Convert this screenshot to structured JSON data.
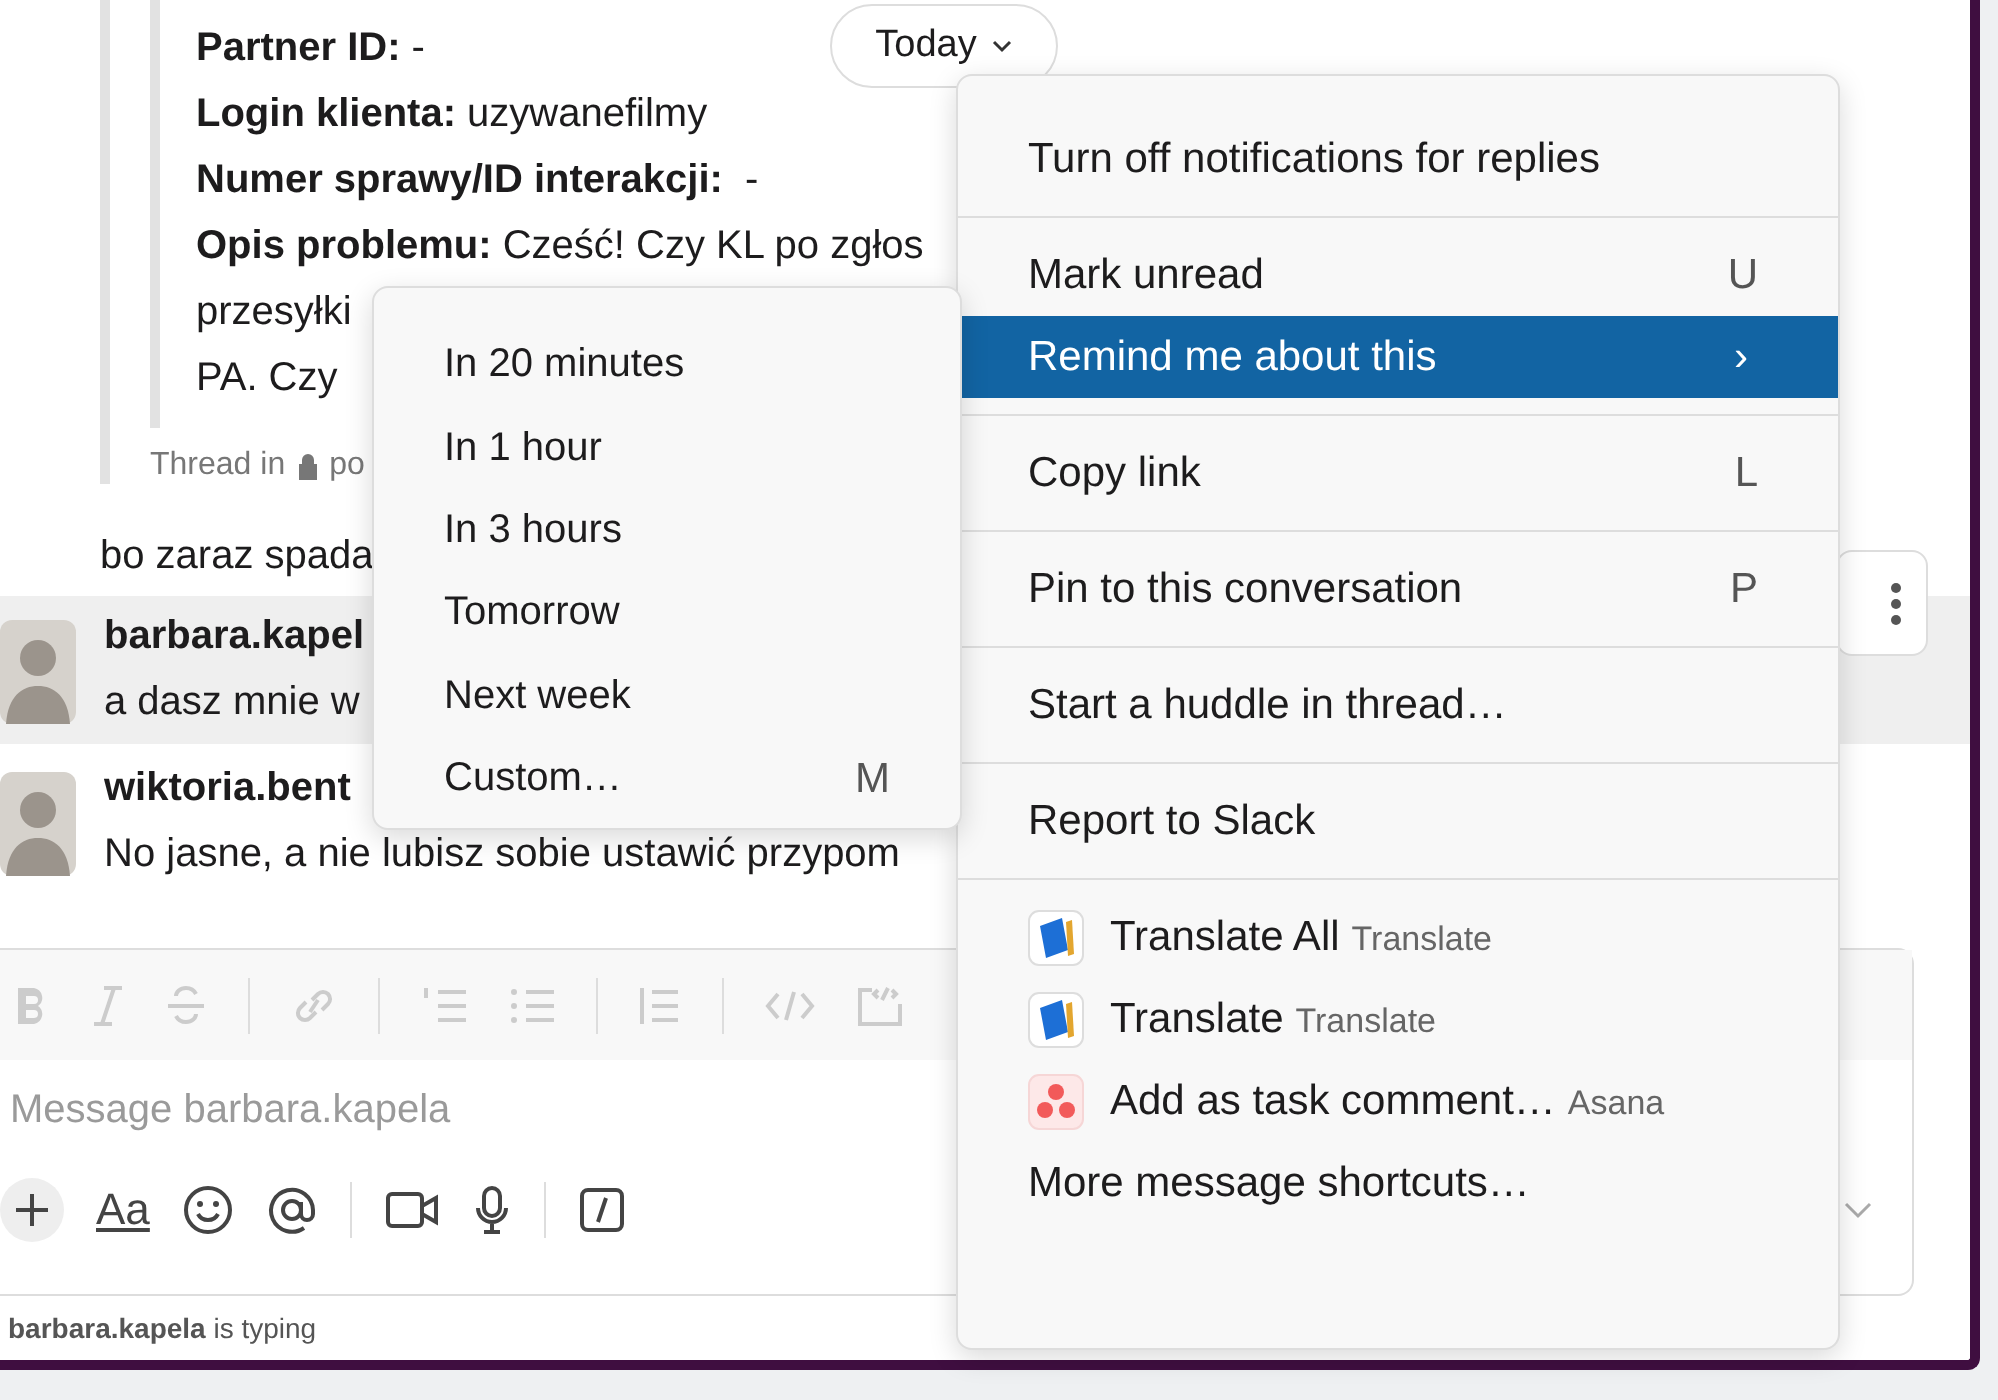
{
  "quote": {
    "lines": [
      "**Partner ID:** -",
      "**Login klienta:** uzywanefilmy",
      "**Numer sprawy/ID interakcji:**  -",
      "**Opis problemu:** Cześć! Czy KL po zgłos",
      "przesyłki",
      "PA. Czy"
    ],
    "thread_prefix": "Thread in",
    "thread_channel": "po"
  },
  "date_pill": {
    "label": "Today"
  },
  "messages": [
    {
      "text": "bo zaraz spada",
      "highlighted": false
    },
    {
      "author": "barbara.kapel",
      "text": "a dasz mnie w",
      "highlighted": true
    },
    {
      "author": "wiktoria.bent",
      "text": "No jasne, a nie lubisz sobie ustawić przypom",
      "highlighted": false
    }
  ],
  "composer": {
    "placeholder": "Message barbara.kapela",
    "format_label": "Aa"
  },
  "typing": {
    "name": "barbara.kapela",
    "text": " is typing"
  },
  "menu": {
    "sections": [
      [
        {
          "kind": "plain",
          "label": "Turn off notifications for replies",
          "selected": false
        }
      ],
      [
        {
          "kind": "plain",
          "label": "Mark unread",
          "shortcut": "U",
          "selected": false
        },
        {
          "kind": "submenu",
          "label": "Remind me about this",
          "shortcut": "›",
          "selected": true
        }
      ],
      [
        {
          "kind": "plain",
          "label": "Copy link",
          "shortcut": "L",
          "selected": false
        }
      ],
      [
        {
          "kind": "plain",
          "label": "Pin to this conversation",
          "shortcut": "P",
          "selected": false
        }
      ],
      [
        {
          "kind": "plain",
          "label": "Start a huddle in thread…",
          "selected": false
        }
      ],
      [
        {
          "kind": "plain",
          "label": "Report to Slack",
          "selected": false
        }
      ],
      [
        {
          "kind": "book-app",
          "label": "Translate All",
          "app": "Translate",
          "selected": false
        },
        {
          "kind": "book-app",
          "label": "Translate",
          "app": "Translate",
          "selected": false
        },
        {
          "kind": "dots-app",
          "label": "Add as task comment…",
          "app": "Asana",
          "selected": false
        },
        {
          "kind": "plain",
          "label": "More message shortcuts…",
          "selected": false
        }
      ]
    ]
  },
  "submenu": {
    "items": [
      {
        "label": "In 20 minutes",
        "selected": false
      },
      {
        "label": "In 1 hour",
        "selected": false
      },
      {
        "label": "In 3 hours",
        "selected": false
      },
      {
        "label": "Tomorrow",
        "selected": false
      },
      {
        "label": "Next week",
        "selected": false
      },
      {
        "label": "Custom…",
        "shortcut": "M",
        "selected": false
      }
    ]
  }
}
